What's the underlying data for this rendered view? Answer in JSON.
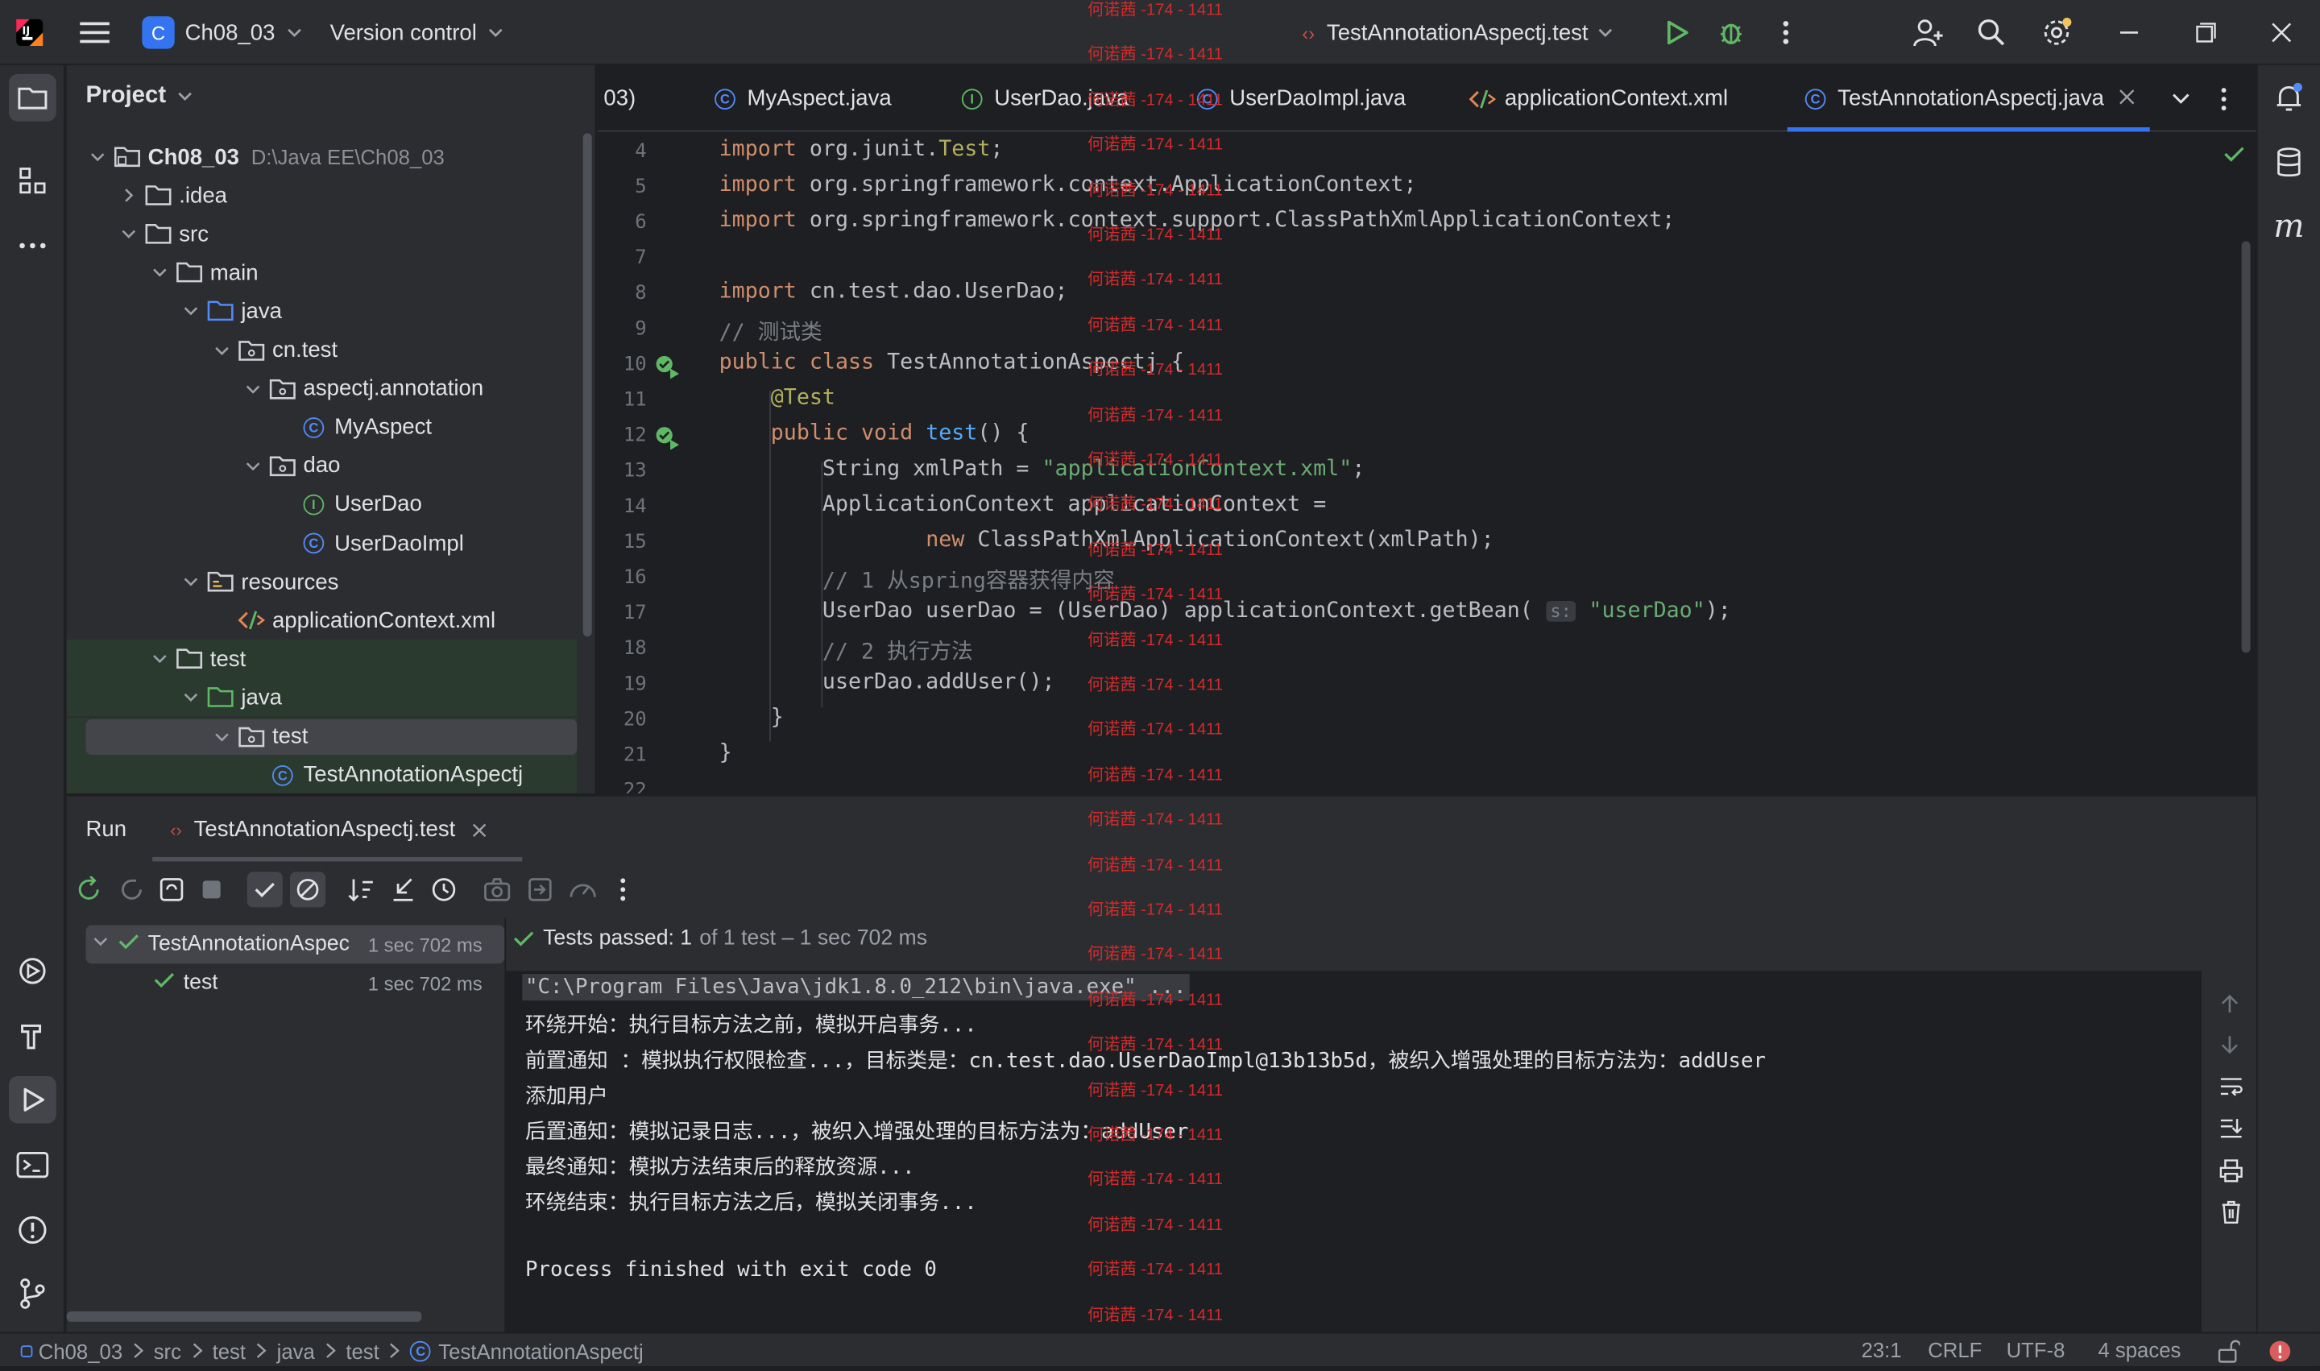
{
  "titlebar": {
    "project_badge": "C",
    "project_name": "Ch08_03",
    "vcs": "Version control",
    "run_config": "TestAnnotationAspectj.test"
  },
  "watermark": "何诺茜 -174 - 1411",
  "project_panel": {
    "title": "Project",
    "tree": [
      {
        "label": "Ch08_03",
        "hint": "D:\\Java EE\\Ch08_03",
        "depth": 0,
        "icon": "module-folder-icon",
        "open": true
      },
      {
        "label": ".idea",
        "depth": 1,
        "icon": "folder-icon",
        "open": false
      },
      {
        "label": "src",
        "depth": 1,
        "icon": "folder-icon",
        "open": true
      },
      {
        "label": "main",
        "depth": 2,
        "icon": "folder-icon",
        "open": true
      },
      {
        "label": "java",
        "depth": 3,
        "icon": "source-folder-icon",
        "open": true
      },
      {
        "label": "cn.test",
        "depth": 4,
        "icon": "package-icon",
        "open": true
      },
      {
        "label": "aspectj.annotation",
        "depth": 5,
        "icon": "package-icon",
        "open": true
      },
      {
        "label": "MyAspect",
        "depth": 6,
        "icon": "class-icon"
      },
      {
        "label": "dao",
        "depth": 5,
        "icon": "package-icon",
        "open": true
      },
      {
        "label": "UserDao",
        "depth": 6,
        "icon": "interface-icon"
      },
      {
        "label": "UserDaoImpl",
        "depth": 6,
        "icon": "class-icon"
      },
      {
        "label": "resources",
        "depth": 3,
        "icon": "resources-folder-icon",
        "open": true
      },
      {
        "label": "applicationContext.xml",
        "depth": 4,
        "icon": "xml-icon"
      },
      {
        "label": "test",
        "depth": 2,
        "icon": "folder-icon",
        "open": true
      },
      {
        "label": "java",
        "depth": 3,
        "icon": "test-folder-icon",
        "open": true
      },
      {
        "label": "test",
        "depth": 4,
        "icon": "package-icon",
        "open": true,
        "selected": true
      },
      {
        "label": "TestAnnotationAspectj",
        "depth": 5,
        "icon": "class-icon"
      }
    ]
  },
  "editor_tabs": [
    {
      "label": "03)",
      "icon": ""
    },
    {
      "label": "MyAspect.java",
      "icon": "class-icon"
    },
    {
      "label": "UserDao.java",
      "icon": "interface-icon"
    },
    {
      "label": "UserDaoImpl.java",
      "icon": "class-icon"
    },
    {
      "label": "applicationContext.xml",
      "icon": "xml-icon"
    },
    {
      "label": "TestAnnotationAspectj.java",
      "icon": "class-icon",
      "active": true
    }
  ],
  "code_lines": [
    {
      "n": "4",
      "html": "<span class='kw'>import</span> org.junit.<span class='ann'>Test</span>;"
    },
    {
      "n": "5",
      "html": "<span class='kw'>import</span> org.springframework.context.ApplicationContext;"
    },
    {
      "n": "6",
      "html": "<span class='kw'>import</span> org.springframework.context.support.ClassPathXmlApplicationContext;"
    },
    {
      "n": "7",
      "html": ""
    },
    {
      "n": "8",
      "html": "<span class='kw'>import</span> cn.test.dao.UserDao;"
    },
    {
      "n": "9",
      "html": "<span class='cm'>// 测试类</span>"
    },
    {
      "n": "10",
      "html": "<span class='kw'>public class</span> TestAnnotationAspectj {"
    },
    {
      "n": "11",
      "html": "    <span class='ann'>@Test</span>"
    },
    {
      "n": "12",
      "html": "    <span class='kw'>public void</span> <span class='fn'>test</span>() {"
    },
    {
      "n": "13",
      "html": "        String xmlPath = <span class='str'>\"applicationContext.xml\"</span>;"
    },
    {
      "n": "14",
      "html": "        ApplicationContext applicationContext ="
    },
    {
      "n": "15",
      "html": "                <span class='kw'>new</span> ClassPathXmlApplicationContext(xmlPath);"
    },
    {
      "n": "16",
      "html": "        <span class='cm'>// 1 从spring容器获得内容</span>"
    },
    {
      "n": "17",
      "html": "        UserDao userDao = (UserDao) applicationContext.getBean( <span class='cm' style='background:#393b40;border-radius:3px;padding:0 3px;font-size:12px'>s:</span> <span class='str'>\"userDao\"</span>);"
    },
    {
      "n": "18",
      "html": "        <span class='cm'>// 2 执行方法</span>"
    },
    {
      "n": "19",
      "html": "        userDao.addUser();"
    },
    {
      "n": "20",
      "html": "    }"
    },
    {
      "n": "21",
      "html": "}"
    },
    {
      "n": "22",
      "html": ""
    }
  ],
  "run_panel": {
    "title": "Run",
    "tab": "TestAnnotationAspectj.test",
    "status_bold": "Tests passed: 1",
    "status_rest": "of 1 test – 1 sec 702 ms",
    "tests": [
      {
        "label": "TestAnnotationAspec",
        "time": "1 sec 702 ms",
        "depth": 0
      },
      {
        "label": "test",
        "time": "1 sec 702 ms",
        "depth": 1
      }
    ],
    "console": [
      "\"C:\\Program Files\\Java\\jdk1.8.0_212\\bin\\java.exe\" ...",
      "环绕开始：执行目标方法之前，模拟开启事务...",
      "前置通知 ：模拟执行权限检查...，目标类是：cn.test.dao.UserDaoImpl@13b13b5d，被织入增强处理的目标方法为：addUser",
      "添加用户",
      "后置通知：模拟记录日志...，被织入增强处理的目标方法为：addUser",
      "最终通知：模拟方法结束后的释放资源...",
      "环绕结束：执行目标方法之后，模拟关闭事务...",
      "",
      "Process finished with exit code 0"
    ]
  },
  "statusbar": {
    "breadcrumbs": [
      "Ch08_03",
      "src",
      "test",
      "java",
      "test",
      "TestAnnotationAspectj"
    ],
    "position": "23:1",
    "line_sep": "CRLF",
    "encoding": "UTF-8",
    "indent": "4 spaces"
  }
}
